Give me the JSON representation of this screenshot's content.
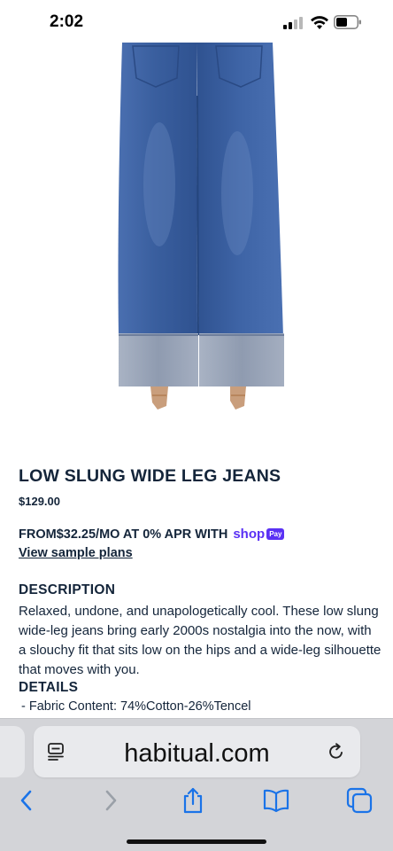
{
  "status_bar": {
    "time": "2:02"
  },
  "product": {
    "image_icon": "jeans-photo",
    "title": "LOW SLUNG WIDE LEG JEANS",
    "price": "$129.00",
    "installments": {
      "prefix": "FROM ",
      "amount": "$32.25",
      "suffix": "/MO AT 0% APR WITH",
      "provider_word": "shop",
      "provider_badge": "Pay"
    },
    "sample_plans_link": "View sample plans",
    "description_heading": "DESCRIPTION",
    "description_body": "Relaxed, undone, and unapologetically cool. These low slung wide-leg jeans bring early 2000s nostalgia into the now, with a slouchy fit that sits low on the hips and a wide-leg silhouette that moves with you.",
    "details_heading": "DETAILS",
    "details_items": [
      "- Fabric Content: 74%Cotton-26%Tencel"
    ]
  },
  "browser": {
    "url": "habitual.com",
    "icons": {
      "page_menu": "page-menu-icon",
      "reload": "reload-icon",
      "back": "chevron-left-icon",
      "forward": "chevron-right-icon",
      "share": "share-icon",
      "bookmarks": "book-icon",
      "tabs": "tabs-icon"
    }
  },
  "colors": {
    "text": "#14253a",
    "shop_pay": "#5a31f4",
    "ios_blue": "#1a73e8",
    "denim": "#3d62a3",
    "cuff": "#9aa6b8"
  }
}
